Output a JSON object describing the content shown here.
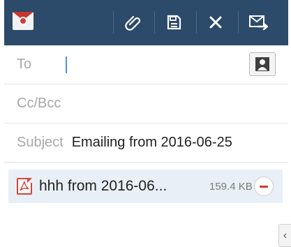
{
  "toolbar": {
    "app_icon": "email-app-icon",
    "buttons": [
      {
        "name": "attach-button",
        "icon": "paperclip-icon"
      },
      {
        "name": "save-draft-button",
        "icon": "save-icon"
      },
      {
        "name": "discard-button",
        "icon": "close-icon"
      },
      {
        "name": "send-button",
        "icon": "send-mail-icon"
      }
    ],
    "colors": {
      "background": "#2c4a6a",
      "icon": "#ffffff"
    }
  },
  "compose": {
    "to_label": "To",
    "to_value": "",
    "contact_icon": "contact-person-icon",
    "cc_bcc_label": "Cc/Bcc",
    "subject_label": "Subject",
    "subject_value": "Emailing from 2016-06-25"
  },
  "attachment": {
    "icon": "pdf-icon",
    "name": "hhh from 2016-06...",
    "size": "159.4 KB",
    "remove_icon": "remove-icon"
  },
  "side_handle": {
    "glyph": "‹"
  }
}
